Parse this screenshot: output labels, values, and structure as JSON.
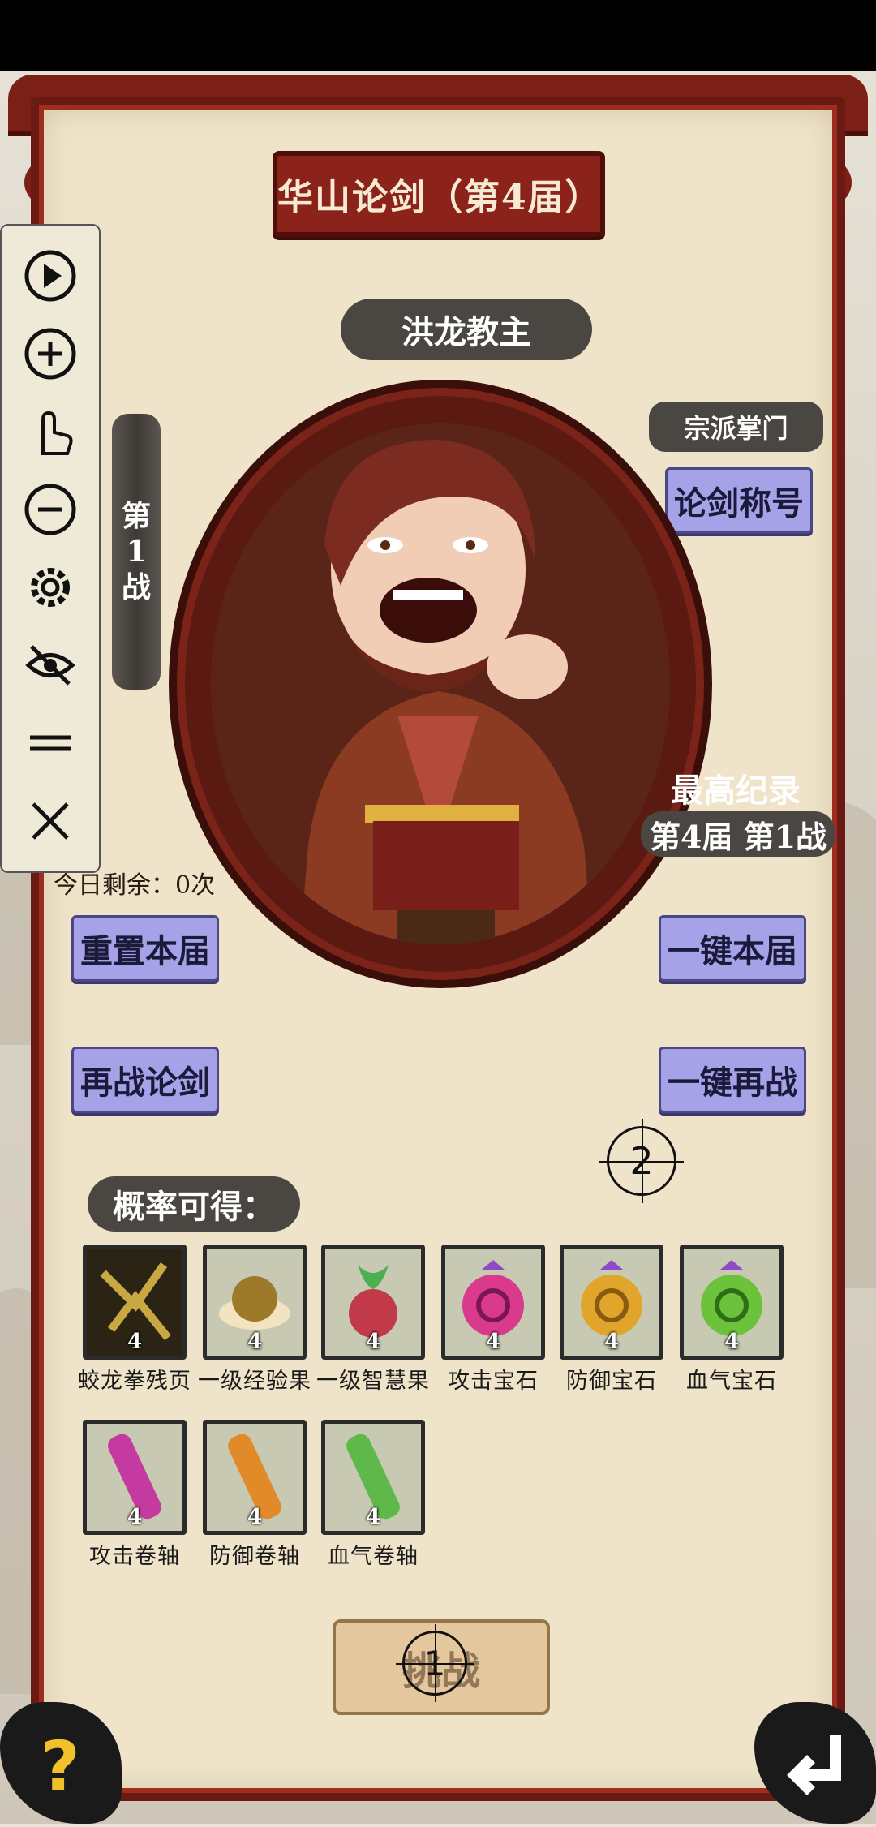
{
  "title": "华山论剑（第4届）",
  "boss": {
    "name": "洪龙教主",
    "sect_title": "宗派掌门"
  },
  "battle_vertical": [
    "第",
    "1",
    "战"
  ],
  "buttons": {
    "title_list": "论剑称号",
    "reset": "重置本届",
    "one_key_current": "一键本届",
    "rematch": "再战论剑",
    "one_key_rematch": "一键再战",
    "challenge": "挑战"
  },
  "record": {
    "label": "最高纪录",
    "value": "第4届 第1战"
  },
  "remaining": "今日剩余：0次",
  "probability_label": "概率可得：",
  "rewards": [
    {
      "name": "蛟龙拳残页",
      "count": "4",
      "color": "#2a2410"
    },
    {
      "name": "一级经验果",
      "count": "4",
      "color": "#9c7a2a"
    },
    {
      "name": "一级智慧果",
      "count": "4",
      "color": "#c23a4a"
    },
    {
      "name": "攻击宝石",
      "count": "4",
      "color": "#d93a8c"
    },
    {
      "name": "防御宝石",
      "count": "4",
      "color": "#e0a52a"
    },
    {
      "name": "血气宝石",
      "count": "4",
      "color": "#6cc23a"
    },
    {
      "name": "攻击卷轴",
      "count": "4",
      "color": "#c43aa0"
    },
    {
      "name": "防御卷轴",
      "count": "4",
      "color": "#e08a2a"
    },
    {
      "name": "血气卷轴",
      "count": "4",
      "color": "#5fb84a"
    }
  ],
  "markers": {
    "m1": "1",
    "m2": "2"
  },
  "toolbar": [
    "play-icon",
    "zoom-in-icon",
    "touch-icon",
    "zoom-out-icon",
    "gear-icon",
    "eye-off-icon",
    "menu-icon",
    "close-icon"
  ],
  "help": "?"
}
